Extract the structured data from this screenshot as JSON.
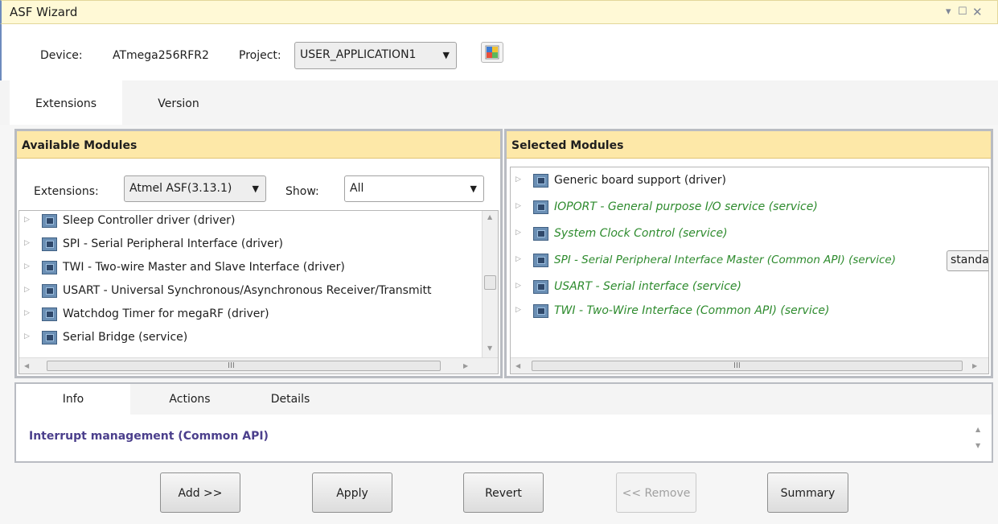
{
  "window": {
    "title": "ASF Wizard"
  },
  "toolbar": {
    "device_label": "Device:",
    "device_value": "ATmega256RFR2",
    "project_label": "Project:",
    "project_value": "USER_APPLICATION1"
  },
  "top_tabs": [
    {
      "label": "Extensions",
      "selected": true
    },
    {
      "label": "Version",
      "selected": false
    }
  ],
  "available": {
    "title": "Available Modules",
    "extensions_label": "Extensions:",
    "extensions_value": "Atmel ASF(3.13.1)",
    "show_label": "Show:",
    "show_value": "All",
    "items": [
      {
        "label": "Sleep Controller driver (driver)"
      },
      {
        "label": "SPI - Serial Peripheral Interface (driver)"
      },
      {
        "label": "TWI - Two-wire Master and Slave Interface (driver)"
      },
      {
        "label": "USART - Universal Synchronous/Asynchronous Receiver/Transmitt"
      },
      {
        "label": "Watchdog Timer for megaRF (driver)"
      },
      {
        "label": "Serial Bridge  (service)"
      }
    ]
  },
  "selected": {
    "title": "Selected Modules",
    "items": [
      {
        "label": "Generic board support (driver)",
        "added": false
      },
      {
        "label": "IOPORT - General purpose I/O service (service)",
        "added": true
      },
      {
        "label": "System Clock Control (service)",
        "added": true
      },
      {
        "label": "SPI - Serial Peripheral Interface Master (Common API) (service)",
        "added": true
      },
      {
        "label": "USART - Serial interface (service)",
        "added": true
      },
      {
        "label": "TWI - Two-Wire Interface (Common API) (service)",
        "added": true
      }
    ],
    "spi_option_value": "standa"
  },
  "info_tabs": [
    {
      "label": "Info",
      "selected": true
    },
    {
      "label": "Actions",
      "selected": false
    },
    {
      "label": "Details",
      "selected": false
    }
  ],
  "info": {
    "text": "Interrupt management (Common API)"
  },
  "buttons": {
    "add": "Add >>",
    "apply": "Apply",
    "revert": "Revert",
    "remove": "<< Remove",
    "summary": "Summary"
  },
  "scrollbar_grip": "III",
  "colors": {
    "accent": "#fde8a8",
    "title_bg": "#fff9d6",
    "added_text": "#2e8b2e",
    "info_text": "#4b3f8c"
  }
}
